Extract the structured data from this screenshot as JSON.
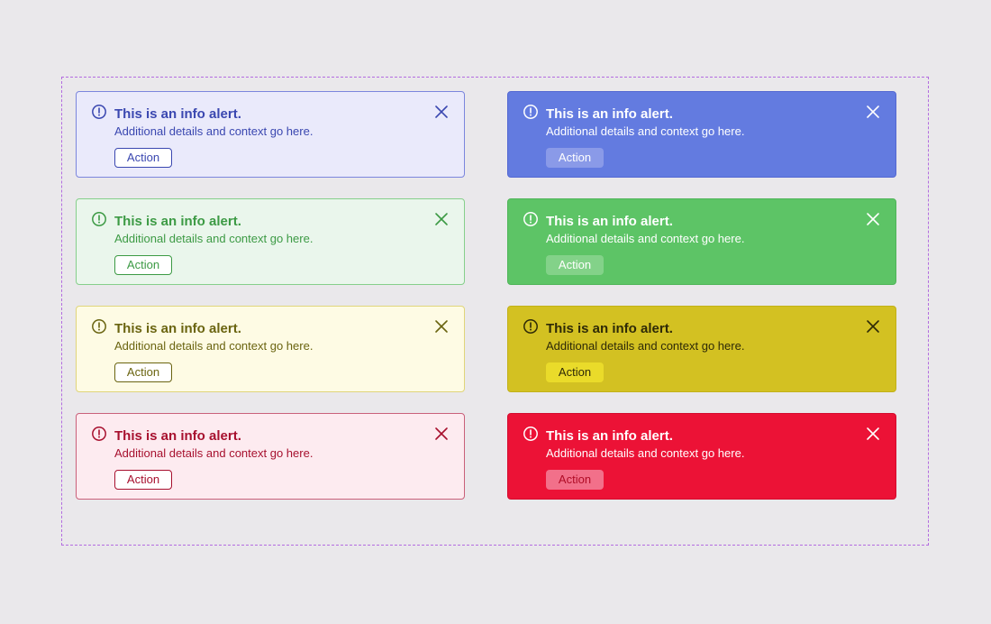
{
  "alerts": [
    {
      "variant": "info-light",
      "title": "This is an info alert.",
      "description": "Additional details and context go here.",
      "action_label": "Action",
      "status_icon": "exclamation-circle-icon",
      "close_icon": "close-x-icon"
    },
    {
      "variant": "info-solid",
      "title": "This is an info alert.",
      "description": "Additional details and context go here.",
      "action_label": "Action",
      "status_icon": "exclamation-circle-icon",
      "close_icon": "close-x-icon"
    },
    {
      "variant": "success-light",
      "title": "This is an info alert.",
      "description": "Additional details and context go here.",
      "action_label": "Action",
      "status_icon": "exclamation-circle-icon",
      "close_icon": "close-x-icon"
    },
    {
      "variant": "success-solid",
      "title": "This is an info alert.",
      "description": "Additional details and context go here.",
      "action_label": "Action",
      "status_icon": "exclamation-circle-icon",
      "close_icon": "close-x-icon"
    },
    {
      "variant": "warning-light",
      "title": "This is an info alert.",
      "description": "Additional details and context go here.",
      "action_label": "Action",
      "status_icon": "exclamation-circle-icon",
      "close_icon": "close-x-icon"
    },
    {
      "variant": "warning-solid",
      "title": "This is an info alert.",
      "description": "Additional details and context go here.",
      "action_label": "Action",
      "status_icon": "exclamation-circle-icon",
      "close_icon": "close-x-icon"
    },
    {
      "variant": "danger-light",
      "title": "This is an info alert.",
      "description": "Additional details and context go here.",
      "action_label": "Action",
      "status_icon": "exclamation-circle-icon",
      "close_icon": "close-x-icon"
    },
    {
      "variant": "danger-solid",
      "title": "This is an info alert.",
      "description": "Additional details and context go here.",
      "action_label": "Action",
      "status_icon": "exclamation-circle-icon",
      "close_icon": "close-x-icon"
    }
  ],
  "colors": {
    "background": "#eae8eb",
    "frame_border": "#b36ce0",
    "info": "#637be0",
    "success": "#5dc466",
    "warning": "#d3c122",
    "danger": "#ec1236"
  }
}
